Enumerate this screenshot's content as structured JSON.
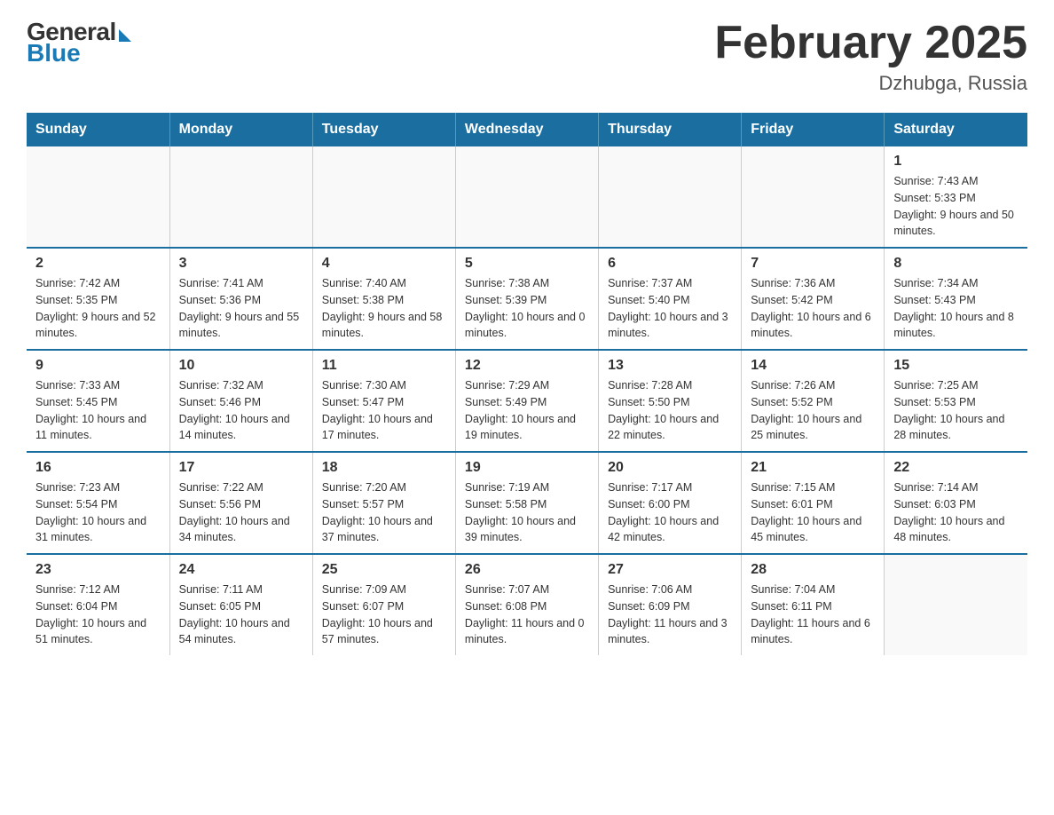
{
  "logo": {
    "general": "General",
    "blue": "Blue"
  },
  "title": "February 2025",
  "location": "Dzhubga, Russia",
  "days_of_week": [
    "Sunday",
    "Monday",
    "Tuesday",
    "Wednesday",
    "Thursday",
    "Friday",
    "Saturday"
  ],
  "weeks": [
    [
      {
        "day": "",
        "sunrise": "",
        "sunset": "",
        "daylight": ""
      },
      {
        "day": "",
        "sunrise": "",
        "sunset": "",
        "daylight": ""
      },
      {
        "day": "",
        "sunrise": "",
        "sunset": "",
        "daylight": ""
      },
      {
        "day": "",
        "sunrise": "",
        "sunset": "",
        "daylight": ""
      },
      {
        "day": "",
        "sunrise": "",
        "sunset": "",
        "daylight": ""
      },
      {
        "day": "",
        "sunrise": "",
        "sunset": "",
        "daylight": ""
      },
      {
        "day": "1",
        "sunrise": "Sunrise: 7:43 AM",
        "sunset": "Sunset: 5:33 PM",
        "daylight": "Daylight: 9 hours and 50 minutes."
      }
    ],
    [
      {
        "day": "2",
        "sunrise": "Sunrise: 7:42 AM",
        "sunset": "Sunset: 5:35 PM",
        "daylight": "Daylight: 9 hours and 52 minutes."
      },
      {
        "day": "3",
        "sunrise": "Sunrise: 7:41 AM",
        "sunset": "Sunset: 5:36 PM",
        "daylight": "Daylight: 9 hours and 55 minutes."
      },
      {
        "day": "4",
        "sunrise": "Sunrise: 7:40 AM",
        "sunset": "Sunset: 5:38 PM",
        "daylight": "Daylight: 9 hours and 58 minutes."
      },
      {
        "day": "5",
        "sunrise": "Sunrise: 7:38 AM",
        "sunset": "Sunset: 5:39 PM",
        "daylight": "Daylight: 10 hours and 0 minutes."
      },
      {
        "day": "6",
        "sunrise": "Sunrise: 7:37 AM",
        "sunset": "Sunset: 5:40 PM",
        "daylight": "Daylight: 10 hours and 3 minutes."
      },
      {
        "day": "7",
        "sunrise": "Sunrise: 7:36 AM",
        "sunset": "Sunset: 5:42 PM",
        "daylight": "Daylight: 10 hours and 6 minutes."
      },
      {
        "day": "8",
        "sunrise": "Sunrise: 7:34 AM",
        "sunset": "Sunset: 5:43 PM",
        "daylight": "Daylight: 10 hours and 8 minutes."
      }
    ],
    [
      {
        "day": "9",
        "sunrise": "Sunrise: 7:33 AM",
        "sunset": "Sunset: 5:45 PM",
        "daylight": "Daylight: 10 hours and 11 minutes."
      },
      {
        "day": "10",
        "sunrise": "Sunrise: 7:32 AM",
        "sunset": "Sunset: 5:46 PM",
        "daylight": "Daylight: 10 hours and 14 minutes."
      },
      {
        "day": "11",
        "sunrise": "Sunrise: 7:30 AM",
        "sunset": "Sunset: 5:47 PM",
        "daylight": "Daylight: 10 hours and 17 minutes."
      },
      {
        "day": "12",
        "sunrise": "Sunrise: 7:29 AM",
        "sunset": "Sunset: 5:49 PM",
        "daylight": "Daylight: 10 hours and 19 minutes."
      },
      {
        "day": "13",
        "sunrise": "Sunrise: 7:28 AM",
        "sunset": "Sunset: 5:50 PM",
        "daylight": "Daylight: 10 hours and 22 minutes."
      },
      {
        "day": "14",
        "sunrise": "Sunrise: 7:26 AM",
        "sunset": "Sunset: 5:52 PM",
        "daylight": "Daylight: 10 hours and 25 minutes."
      },
      {
        "day": "15",
        "sunrise": "Sunrise: 7:25 AM",
        "sunset": "Sunset: 5:53 PM",
        "daylight": "Daylight: 10 hours and 28 minutes."
      }
    ],
    [
      {
        "day": "16",
        "sunrise": "Sunrise: 7:23 AM",
        "sunset": "Sunset: 5:54 PM",
        "daylight": "Daylight: 10 hours and 31 minutes."
      },
      {
        "day": "17",
        "sunrise": "Sunrise: 7:22 AM",
        "sunset": "Sunset: 5:56 PM",
        "daylight": "Daylight: 10 hours and 34 minutes."
      },
      {
        "day": "18",
        "sunrise": "Sunrise: 7:20 AM",
        "sunset": "Sunset: 5:57 PM",
        "daylight": "Daylight: 10 hours and 37 minutes."
      },
      {
        "day": "19",
        "sunrise": "Sunrise: 7:19 AM",
        "sunset": "Sunset: 5:58 PM",
        "daylight": "Daylight: 10 hours and 39 minutes."
      },
      {
        "day": "20",
        "sunrise": "Sunrise: 7:17 AM",
        "sunset": "Sunset: 6:00 PM",
        "daylight": "Daylight: 10 hours and 42 minutes."
      },
      {
        "day": "21",
        "sunrise": "Sunrise: 7:15 AM",
        "sunset": "Sunset: 6:01 PM",
        "daylight": "Daylight: 10 hours and 45 minutes."
      },
      {
        "day": "22",
        "sunrise": "Sunrise: 7:14 AM",
        "sunset": "Sunset: 6:03 PM",
        "daylight": "Daylight: 10 hours and 48 minutes."
      }
    ],
    [
      {
        "day": "23",
        "sunrise": "Sunrise: 7:12 AM",
        "sunset": "Sunset: 6:04 PM",
        "daylight": "Daylight: 10 hours and 51 minutes."
      },
      {
        "day": "24",
        "sunrise": "Sunrise: 7:11 AM",
        "sunset": "Sunset: 6:05 PM",
        "daylight": "Daylight: 10 hours and 54 minutes."
      },
      {
        "day": "25",
        "sunrise": "Sunrise: 7:09 AM",
        "sunset": "Sunset: 6:07 PM",
        "daylight": "Daylight: 10 hours and 57 minutes."
      },
      {
        "day": "26",
        "sunrise": "Sunrise: 7:07 AM",
        "sunset": "Sunset: 6:08 PM",
        "daylight": "Daylight: 11 hours and 0 minutes."
      },
      {
        "day": "27",
        "sunrise": "Sunrise: 7:06 AM",
        "sunset": "Sunset: 6:09 PM",
        "daylight": "Daylight: 11 hours and 3 minutes."
      },
      {
        "day": "28",
        "sunrise": "Sunrise: 7:04 AM",
        "sunset": "Sunset: 6:11 PM",
        "daylight": "Daylight: 11 hours and 6 minutes."
      },
      {
        "day": "",
        "sunrise": "",
        "sunset": "",
        "daylight": ""
      }
    ]
  ]
}
